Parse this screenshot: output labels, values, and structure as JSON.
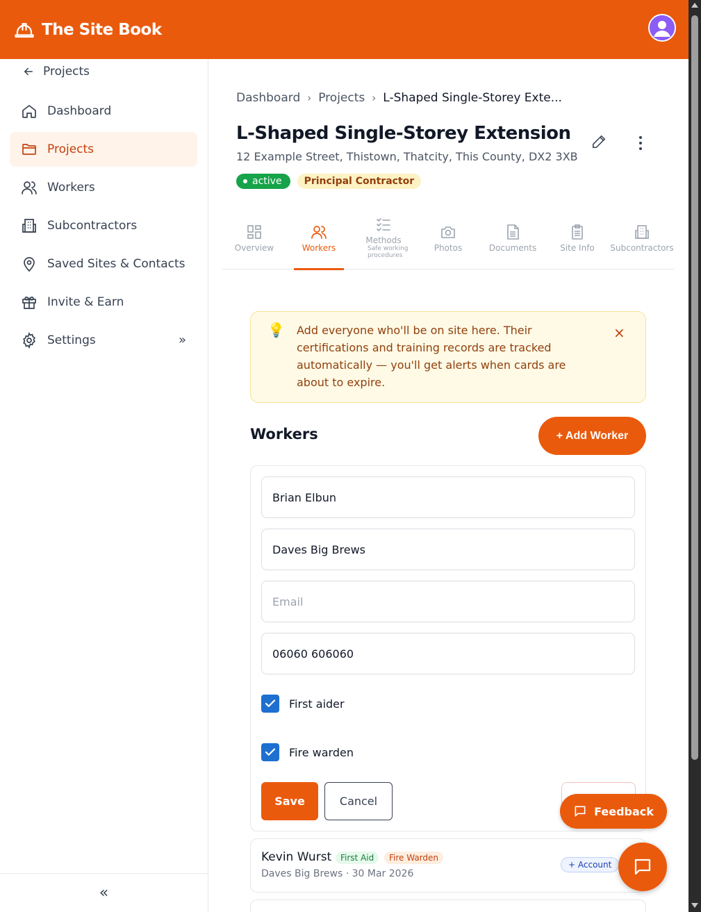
{
  "app": {
    "name": "The Site Book"
  },
  "colors": {
    "brand": "#ea5a0c",
    "active_badge": "#16a34a",
    "checkbox": "#1d6fd0"
  },
  "sidebar": {
    "back_label": "Projects",
    "items": [
      {
        "label": "Dashboard",
        "icon": "home-icon"
      },
      {
        "label": "Projects",
        "icon": "folder-icon",
        "active": true
      },
      {
        "label": "Workers",
        "icon": "users-icon"
      },
      {
        "label": "Subcontractors",
        "icon": "building-icon"
      },
      {
        "label": "Saved Sites & Contacts",
        "icon": "map-pin-icon"
      },
      {
        "label": "Invite & Earn",
        "icon": "gift-icon"
      },
      {
        "label": "Settings",
        "icon": "gear-icon"
      }
    ],
    "settings_chevron": "»",
    "collapse_label": "«"
  },
  "breadcrumb": [
    "Dashboard",
    "Projects",
    "L-Shaped Single-Storey Exte..."
  ],
  "project": {
    "title": "L-Shaped Single-Storey Extension",
    "address": "12 Example Street, Thistown, Thatcity, This County, DX2 3XB",
    "status": "active",
    "role": "Principal Contractor"
  },
  "tabs": [
    {
      "label": "Overview",
      "icon": "grid-icon"
    },
    {
      "label": "Workers",
      "icon": "users-icon",
      "active": true
    },
    {
      "label": "Methods",
      "sub": "Safe working procedures",
      "icon": "checklist-icon"
    },
    {
      "label": "Photos",
      "icon": "camera-icon"
    },
    {
      "label": "Documents",
      "icon": "document-icon"
    },
    {
      "label": "Site Info",
      "icon": "clipboard-icon"
    },
    {
      "label": "Subcontractors",
      "icon": "building-icon"
    }
  ],
  "tip": {
    "text": "Add everyone who'll be on site here. Their certifications and training records are tracked automatically — you'll get alerts when cards are about to expire.",
    "icon": "lightbulb-icon",
    "close": "×"
  },
  "workers_section": {
    "title": "Workers",
    "add_button": "+ Add Worker"
  },
  "form": {
    "name_value": "Brian Elbun",
    "company_value": "Daves Big Brews",
    "email_value": "",
    "email_placeholder": "Email",
    "phone_value": "06060 606060",
    "first_aider_label": "First aider",
    "fire_warden_label": "Fire warden",
    "save_label": "Save",
    "cancel_label": "Cancel"
  },
  "worker_list": [
    {
      "name": "Kevin Wurst",
      "tags": [
        "First Aid",
        "Fire Warden"
      ],
      "sub": "Daves Big Brews · 30 Mar 2026",
      "account_label": "+ Account"
    }
  ],
  "feedback": {
    "label": "Feedback"
  }
}
